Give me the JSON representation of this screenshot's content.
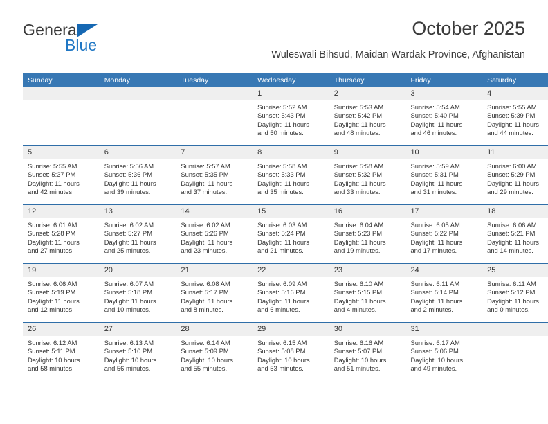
{
  "brand": {
    "name_top": "General",
    "name_bottom": "Blue",
    "accent_color": "#2077c4",
    "triangle_color": "#1668b3"
  },
  "header": {
    "title": "October 2025",
    "subtitle": "Wuleswali Bihsud, Maidan Wardak Province, Afghanistan"
  },
  "calendar": {
    "header_bg": "#3878b4",
    "row_divider_color": "#2f6ea8",
    "daynum_bg": "#efefef",
    "weekdays": [
      "Sunday",
      "Monday",
      "Tuesday",
      "Wednesday",
      "Thursday",
      "Friday",
      "Saturday"
    ],
    "weeks": [
      [
        {
          "day": "",
          "blank": true
        },
        {
          "day": "",
          "blank": true
        },
        {
          "day": "",
          "blank": true
        },
        {
          "day": "1",
          "sunrise": "Sunrise: 5:52 AM",
          "sunset": "Sunset: 5:43 PM",
          "daylight_1": "Daylight: 11 hours",
          "daylight_2": "and 50 minutes."
        },
        {
          "day": "2",
          "sunrise": "Sunrise: 5:53 AM",
          "sunset": "Sunset: 5:42 PM",
          "daylight_1": "Daylight: 11 hours",
          "daylight_2": "and 48 minutes."
        },
        {
          "day": "3",
          "sunrise": "Sunrise: 5:54 AM",
          "sunset": "Sunset: 5:40 PM",
          "daylight_1": "Daylight: 11 hours",
          "daylight_2": "and 46 minutes."
        },
        {
          "day": "4",
          "sunrise": "Sunrise: 5:55 AM",
          "sunset": "Sunset: 5:39 PM",
          "daylight_1": "Daylight: 11 hours",
          "daylight_2": "and 44 minutes."
        }
      ],
      [
        {
          "day": "5",
          "sunrise": "Sunrise: 5:55 AM",
          "sunset": "Sunset: 5:37 PM",
          "daylight_1": "Daylight: 11 hours",
          "daylight_2": "and 42 minutes."
        },
        {
          "day": "6",
          "sunrise": "Sunrise: 5:56 AM",
          "sunset": "Sunset: 5:36 PM",
          "daylight_1": "Daylight: 11 hours",
          "daylight_2": "and 39 minutes."
        },
        {
          "day": "7",
          "sunrise": "Sunrise: 5:57 AM",
          "sunset": "Sunset: 5:35 PM",
          "daylight_1": "Daylight: 11 hours",
          "daylight_2": "and 37 minutes."
        },
        {
          "day": "8",
          "sunrise": "Sunrise: 5:58 AM",
          "sunset": "Sunset: 5:33 PM",
          "daylight_1": "Daylight: 11 hours",
          "daylight_2": "and 35 minutes."
        },
        {
          "day": "9",
          "sunrise": "Sunrise: 5:58 AM",
          "sunset": "Sunset: 5:32 PM",
          "daylight_1": "Daylight: 11 hours",
          "daylight_2": "and 33 minutes."
        },
        {
          "day": "10",
          "sunrise": "Sunrise: 5:59 AM",
          "sunset": "Sunset: 5:31 PM",
          "daylight_1": "Daylight: 11 hours",
          "daylight_2": "and 31 minutes."
        },
        {
          "day": "11",
          "sunrise": "Sunrise: 6:00 AM",
          "sunset": "Sunset: 5:29 PM",
          "daylight_1": "Daylight: 11 hours",
          "daylight_2": "and 29 minutes."
        }
      ],
      [
        {
          "day": "12",
          "sunrise": "Sunrise: 6:01 AM",
          "sunset": "Sunset: 5:28 PM",
          "daylight_1": "Daylight: 11 hours",
          "daylight_2": "and 27 minutes."
        },
        {
          "day": "13",
          "sunrise": "Sunrise: 6:02 AM",
          "sunset": "Sunset: 5:27 PM",
          "daylight_1": "Daylight: 11 hours",
          "daylight_2": "and 25 minutes."
        },
        {
          "day": "14",
          "sunrise": "Sunrise: 6:02 AM",
          "sunset": "Sunset: 5:26 PM",
          "daylight_1": "Daylight: 11 hours",
          "daylight_2": "and 23 minutes."
        },
        {
          "day": "15",
          "sunrise": "Sunrise: 6:03 AM",
          "sunset": "Sunset: 5:24 PM",
          "daylight_1": "Daylight: 11 hours",
          "daylight_2": "and 21 minutes."
        },
        {
          "day": "16",
          "sunrise": "Sunrise: 6:04 AM",
          "sunset": "Sunset: 5:23 PM",
          "daylight_1": "Daylight: 11 hours",
          "daylight_2": "and 19 minutes."
        },
        {
          "day": "17",
          "sunrise": "Sunrise: 6:05 AM",
          "sunset": "Sunset: 5:22 PM",
          "daylight_1": "Daylight: 11 hours",
          "daylight_2": "and 17 minutes."
        },
        {
          "day": "18",
          "sunrise": "Sunrise: 6:06 AM",
          "sunset": "Sunset: 5:21 PM",
          "daylight_1": "Daylight: 11 hours",
          "daylight_2": "and 14 minutes."
        }
      ],
      [
        {
          "day": "19",
          "sunrise": "Sunrise: 6:06 AM",
          "sunset": "Sunset: 5:19 PM",
          "daylight_1": "Daylight: 11 hours",
          "daylight_2": "and 12 minutes."
        },
        {
          "day": "20",
          "sunrise": "Sunrise: 6:07 AM",
          "sunset": "Sunset: 5:18 PM",
          "daylight_1": "Daylight: 11 hours",
          "daylight_2": "and 10 minutes."
        },
        {
          "day": "21",
          "sunrise": "Sunrise: 6:08 AM",
          "sunset": "Sunset: 5:17 PM",
          "daylight_1": "Daylight: 11 hours",
          "daylight_2": "and 8 minutes."
        },
        {
          "day": "22",
          "sunrise": "Sunrise: 6:09 AM",
          "sunset": "Sunset: 5:16 PM",
          "daylight_1": "Daylight: 11 hours",
          "daylight_2": "and 6 minutes."
        },
        {
          "day": "23",
          "sunrise": "Sunrise: 6:10 AM",
          "sunset": "Sunset: 5:15 PM",
          "daylight_1": "Daylight: 11 hours",
          "daylight_2": "and 4 minutes."
        },
        {
          "day": "24",
          "sunrise": "Sunrise: 6:11 AM",
          "sunset": "Sunset: 5:14 PM",
          "daylight_1": "Daylight: 11 hours",
          "daylight_2": "and 2 minutes."
        },
        {
          "day": "25",
          "sunrise": "Sunrise: 6:11 AM",
          "sunset": "Sunset: 5:12 PM",
          "daylight_1": "Daylight: 11 hours",
          "daylight_2": "and 0 minutes."
        }
      ],
      [
        {
          "day": "26",
          "sunrise": "Sunrise: 6:12 AM",
          "sunset": "Sunset: 5:11 PM",
          "daylight_1": "Daylight: 10 hours",
          "daylight_2": "and 58 minutes."
        },
        {
          "day": "27",
          "sunrise": "Sunrise: 6:13 AM",
          "sunset": "Sunset: 5:10 PM",
          "daylight_1": "Daylight: 10 hours",
          "daylight_2": "and 56 minutes."
        },
        {
          "day": "28",
          "sunrise": "Sunrise: 6:14 AM",
          "sunset": "Sunset: 5:09 PM",
          "daylight_1": "Daylight: 10 hours",
          "daylight_2": "and 55 minutes."
        },
        {
          "day": "29",
          "sunrise": "Sunrise: 6:15 AM",
          "sunset": "Sunset: 5:08 PM",
          "daylight_1": "Daylight: 10 hours",
          "daylight_2": "and 53 minutes."
        },
        {
          "day": "30",
          "sunrise": "Sunrise: 6:16 AM",
          "sunset": "Sunset: 5:07 PM",
          "daylight_1": "Daylight: 10 hours",
          "daylight_2": "and 51 minutes."
        },
        {
          "day": "31",
          "sunrise": "Sunrise: 6:17 AM",
          "sunset": "Sunset: 5:06 PM",
          "daylight_1": "Daylight: 10 hours",
          "daylight_2": "and 49 minutes."
        },
        {
          "day": "",
          "blank": true
        }
      ]
    ]
  }
}
